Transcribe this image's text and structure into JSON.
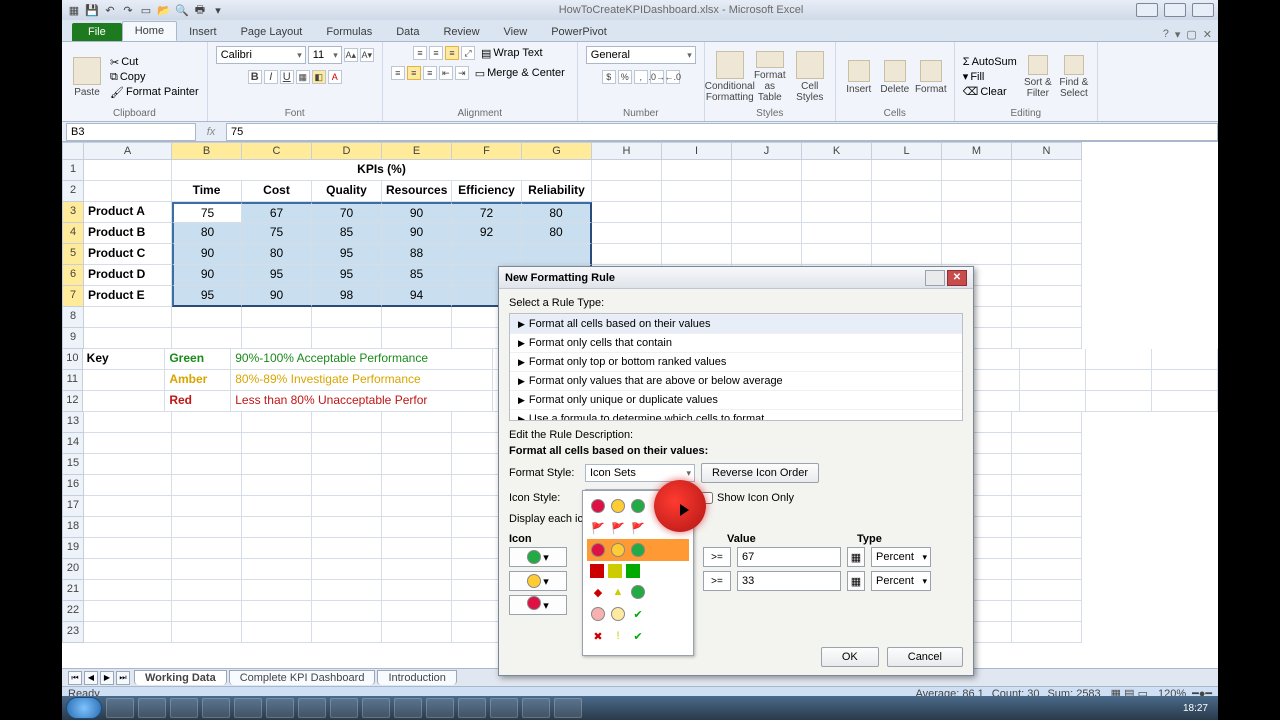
{
  "app_title": "HowToCreateKPIDashboard.xlsx - Microsoft Excel",
  "ribbon_tabs": [
    "File",
    "Home",
    "Insert",
    "Page Layout",
    "Formulas",
    "Data",
    "Review",
    "View",
    "PowerPivot"
  ],
  "clipboard": {
    "cut": "Cut",
    "copy": "Copy",
    "fmt": "Format Painter",
    "label": "Clipboard",
    "paste": "Paste"
  },
  "font": {
    "name": "Calibri",
    "size": "11",
    "label": "Font"
  },
  "alignment": {
    "wrap": "Wrap Text",
    "merge": "Merge & Center",
    "label": "Alignment"
  },
  "number": {
    "format": "General",
    "label": "Number"
  },
  "styles": {
    "cf": "Conditional\nFormatting",
    "fat": "Format\nas Table",
    "cs": "Cell\nStyles",
    "label": "Styles"
  },
  "cells": {
    "ins": "Insert",
    "del": "Delete",
    "fmt": "Format",
    "label": "Cells"
  },
  "editing": {
    "sum": "AutoSum",
    "fill": "Fill",
    "clear": "Clear",
    "sort": "Sort &\nFilter",
    "find": "Find &\nSelect",
    "label": "Editing"
  },
  "namebox": "B3",
  "formula": "75",
  "columns": [
    "A",
    "B",
    "C",
    "D",
    "E",
    "F",
    "G",
    "H",
    "I",
    "J",
    "K",
    "L",
    "M",
    "N"
  ],
  "title_cell": "KPIs (%)",
  "headers": [
    "Time",
    "Cost",
    "Quality",
    "Resources",
    "Efficiency",
    "Reliability"
  ],
  "products": [
    "Product A",
    "Product B",
    "Product C",
    "Product D",
    "Product E"
  ],
  "data": [
    [
      75,
      67,
      70,
      90,
      72,
      80
    ],
    [
      80,
      75,
      85,
      90,
      92,
      80
    ],
    [
      90,
      80,
      95,
      88,
      null,
      null
    ],
    [
      90,
      95,
      95,
      85,
      null,
      null
    ],
    [
      95,
      90,
      98,
      94,
      null,
      null
    ]
  ],
  "key": {
    "label": "Key",
    "green": {
      "name": "Green",
      "desc": "90%-100% Acceptable Performance"
    },
    "amber": {
      "name": "Amber",
      "desc": "80%-89% Investigate Performance"
    },
    "red": {
      "name": "Red",
      "desc": "Less than 80% Unacceptable Perfor"
    }
  },
  "sheets": {
    "a": "Working Data",
    "b": "Complete KPI Dashboard",
    "c": "Introduction"
  },
  "statusbar": {
    "ready": "Ready",
    "avg": "Average: 86.1",
    "count": "Count: 30",
    "sum": "Sum: 2583",
    "zoom": "120%"
  },
  "dialog": {
    "title": "New Formatting Rule",
    "select": "Select a Rule Type:",
    "types": [
      "Format all cells based on their values",
      "Format only cells that contain",
      "Format only top or bottom ranked values",
      "Format only values that are above or below average",
      "Format only unique or duplicate values",
      "Use a formula to determine which cells to format"
    ],
    "edit": "Edit the Rule Description:",
    "heading": "Format all cells based on their values:",
    "format_style_lbl": "Format Style:",
    "format_style": "Icon Sets",
    "icon_style_lbl": "Icon Style:",
    "reverse": "Reverse Icon Order",
    "show_only": "Show Icon Only",
    "display": "Display each ico",
    "icon_h": "Icon",
    "value_h": "Value",
    "type_h": "Type",
    "rel": ">=",
    "v1": "67",
    "v2": "33",
    "type": "Percent",
    "ok": "OK",
    "cancel": "Cancel"
  },
  "taskbar_clock": "18:27"
}
